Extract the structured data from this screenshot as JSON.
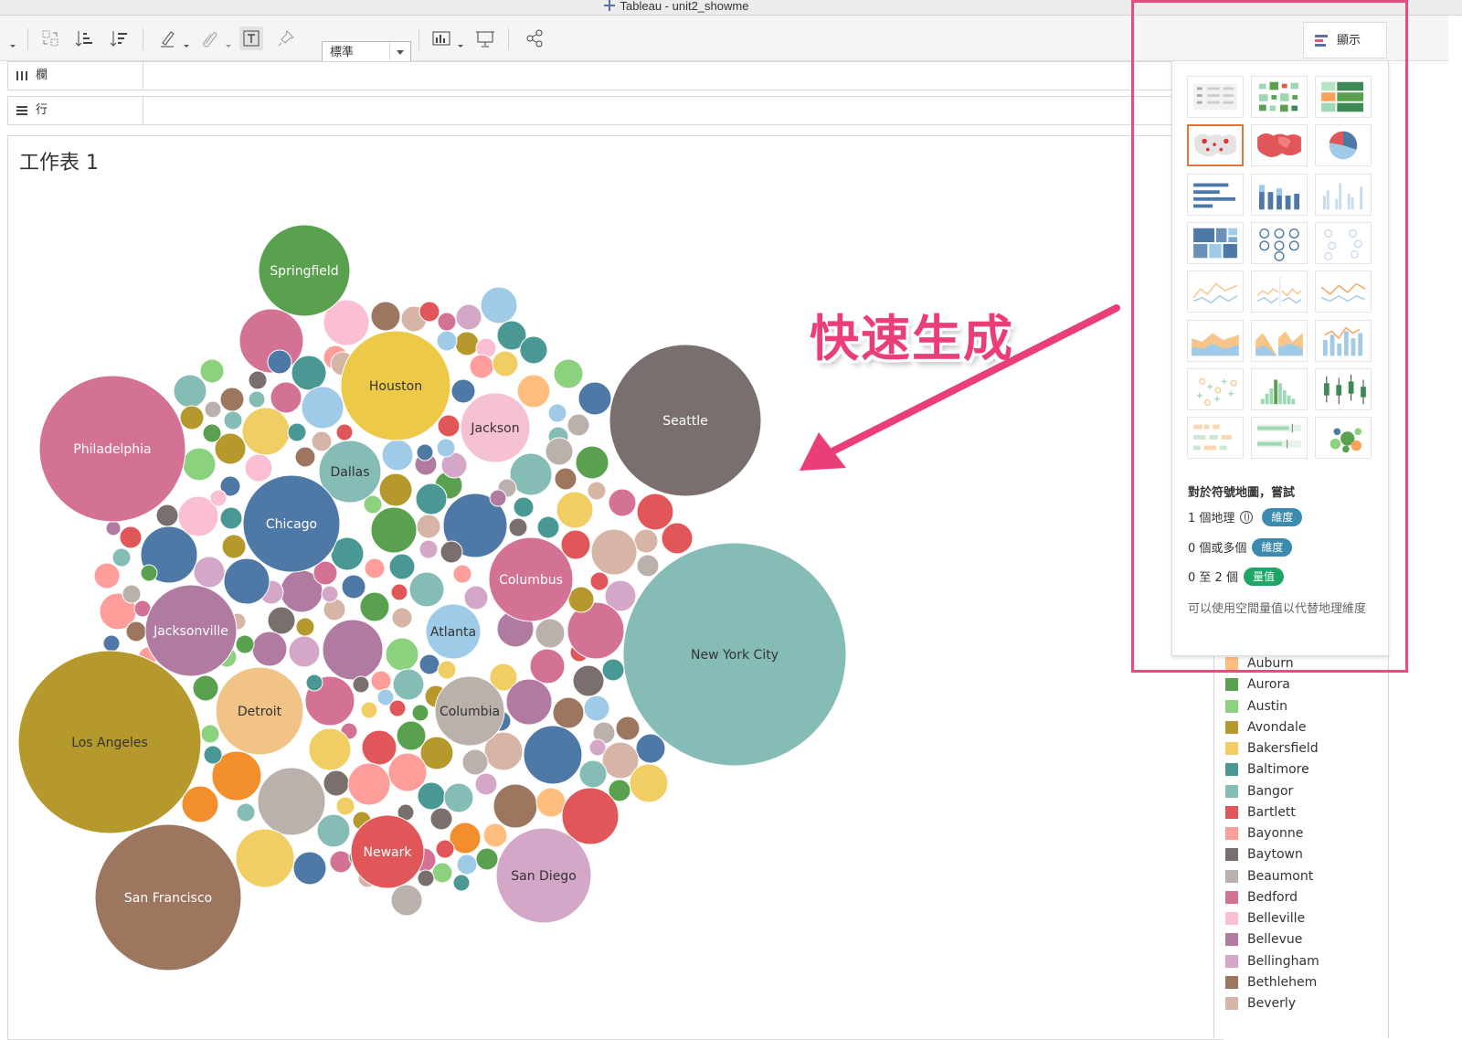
{
  "window": {
    "title": "Tableau - unit2_showme"
  },
  "toolbar": {
    "fit_value": "標準",
    "icons": [
      "swap-rows-columns-icon",
      "sort-ascending-icon",
      "sort-descending-icon",
      "highlight-icon",
      "annotate-icon",
      "show-labels-icon",
      "pin-icon",
      "chart-options-icon",
      "presentation-icon",
      "share-icon"
    ]
  },
  "shelves": {
    "columns_label": "欄",
    "rows_label": "行"
  },
  "sheet": {
    "title": "工作表 1"
  },
  "colors": {
    "highlight_box": "#e84b7f",
    "annotation": "#ea3e77",
    "dimension_pill": "#3a8bae",
    "measure_pill": "#1fa567",
    "selected_thumb": "#e0773a"
  },
  "chart_data": {
    "type": "packed-bubbles",
    "labeled_bubbles": [
      {
        "name": "Springfield",
        "color": "#59a14f"
      },
      {
        "name": "Houston",
        "color": "#edc948"
      },
      {
        "name": "Jackson",
        "color": "#f4c0d2"
      },
      {
        "name": "Seattle",
        "color": "#79706e"
      },
      {
        "name": "Philadelphia",
        "color": "#d37295"
      },
      {
        "name": "Dallas",
        "color": "#86bcb6"
      },
      {
        "name": "Chicago",
        "color": "#4e79a7"
      },
      {
        "name": "Columbus",
        "color": "#d37295"
      },
      {
        "name": "Jacksonville",
        "color": "#b07aa1"
      },
      {
        "name": "Atlanta",
        "color": "#a0cbe8"
      },
      {
        "name": "New York City",
        "color": "#86bcb6"
      },
      {
        "name": "Detroit",
        "color": "#f1c386"
      },
      {
        "name": "Columbia",
        "color": "#bab0ac"
      },
      {
        "name": "Los Angeles",
        "color": "#b6992d"
      },
      {
        "name": "Newark",
        "color": "#e15759"
      },
      {
        "name": "San Diego",
        "color": "#d4a6c8"
      },
      {
        "name": "San Francisco",
        "color": "#9d7660"
      }
    ]
  },
  "legend": {
    "items": [
      {
        "name": "Auburn",
        "color": "#ffbe7d"
      },
      {
        "name": "Aurora",
        "color": "#59a14f"
      },
      {
        "name": "Austin",
        "color": "#8cd17d"
      },
      {
        "name": "Avondale",
        "color": "#b6992d"
      },
      {
        "name": "Bakersfield",
        "color": "#f1ce63"
      },
      {
        "name": "Baltimore",
        "color": "#499894"
      },
      {
        "name": "Bangor",
        "color": "#86bcb6"
      },
      {
        "name": "Bartlett",
        "color": "#e15759"
      },
      {
        "name": "Bayonne",
        "color": "#ff9d9a"
      },
      {
        "name": "Baytown",
        "color": "#79706e"
      },
      {
        "name": "Beaumont",
        "color": "#bab0ac"
      },
      {
        "name": "Bedford",
        "color": "#d37295"
      },
      {
        "name": "Belleville",
        "color": "#fabfd2"
      },
      {
        "name": "Bellevue",
        "color": "#b07aa1"
      },
      {
        "name": "Bellingham",
        "color": "#d4a6c8"
      },
      {
        "name": "Bethlehem",
        "color": "#9d7660"
      },
      {
        "name": "Beverly",
        "color": "#d7b5a6"
      }
    ]
  },
  "show_me": {
    "button_label": "顯示",
    "hint_title": "對於符號地圖，嘗試",
    "req1_prefix": "1 個地理",
    "req2_prefix": "0 個或多個",
    "req3_prefix": "0 至 2 個",
    "dim_pill": "維度",
    "mes_pill": "量值",
    "note": "可以使用空間量值以代替地理維度"
  },
  "annotation": {
    "text": "快速生成"
  }
}
